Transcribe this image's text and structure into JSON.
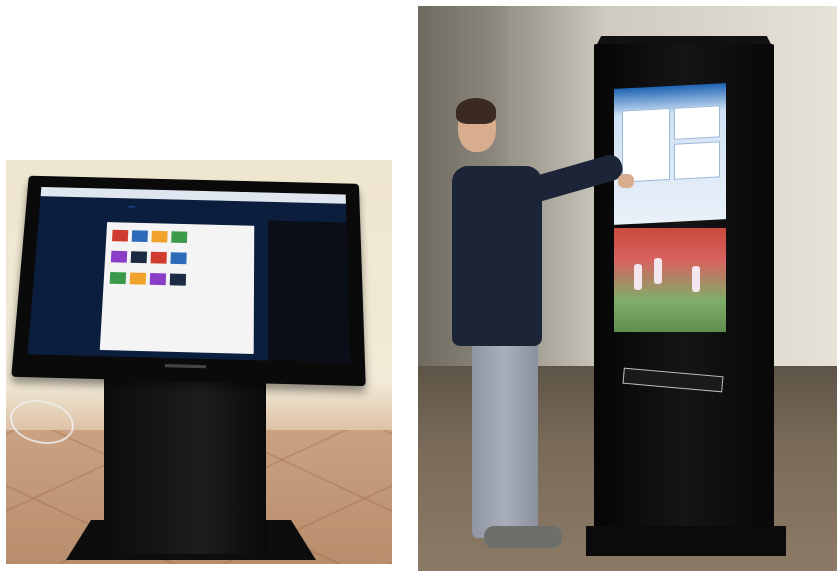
{
  "image": {
    "description_panels": [
      "left-kiosk-photo",
      "right-kiosk-photo"
    ]
  },
  "left_kiosk": {
    "site_logo_text": "",
    "site_phone_text": "",
    "tile_colors": [
      "#d13b2f",
      "#2b6bb8",
      "#f0a22a",
      "#3c9a4b",
      "#8a3ec7",
      "#1c2a44"
    ]
  },
  "right_kiosk": {
    "totem_logo_text": "",
    "ad_text": ""
  }
}
